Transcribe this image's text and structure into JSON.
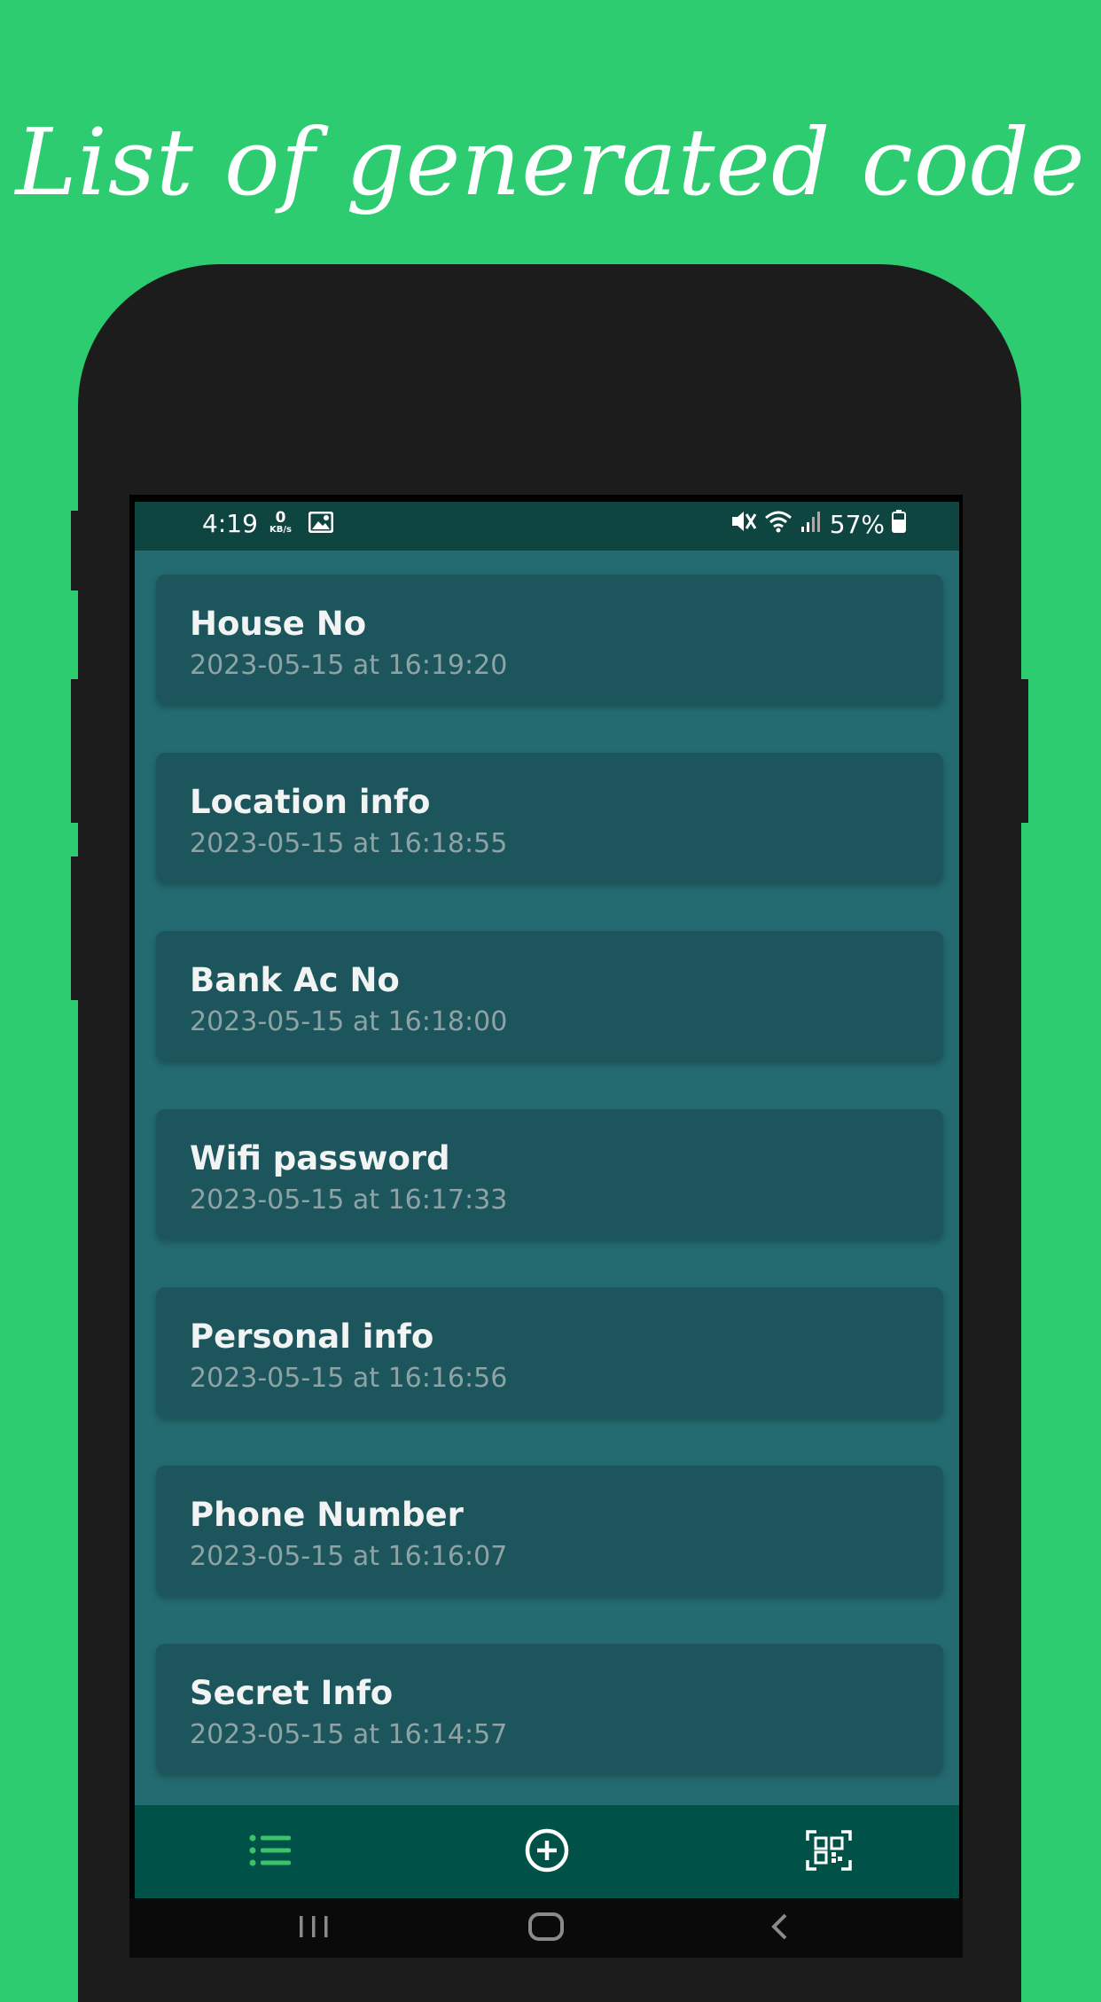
{
  "headline": "List of generated code",
  "status_bar": {
    "time": "4:19",
    "net_speed_value": "0",
    "net_speed_unit": "KB/s",
    "battery": "57%"
  },
  "items": [
    {
      "title": "House No",
      "timestamp": "2023-05-15 at 16:19:20"
    },
    {
      "title": "Location info",
      "timestamp": "2023-05-15 at 16:18:55"
    },
    {
      "title": "Bank Ac No",
      "timestamp": "2023-05-15 at 16:18:00"
    },
    {
      "title": "Wifi password",
      "timestamp": "2023-05-15 at 16:17:33"
    },
    {
      "title": "Personal info",
      "timestamp": "2023-05-15 at 16:16:56"
    },
    {
      "title": "Phone Number",
      "timestamp": "2023-05-15 at 16:16:07"
    },
    {
      "title": "Secret Info",
      "timestamp": "2023-05-15 at 16:14:57"
    }
  ],
  "bottom_nav": {
    "items": [
      {
        "icon": "list-icon",
        "active": true
      },
      {
        "icon": "add-circle-icon",
        "active": false
      },
      {
        "icon": "qr-code-icon",
        "active": false
      }
    ]
  },
  "system_nav": [
    "recents-icon",
    "home-icon",
    "back-icon"
  ],
  "colors": {
    "background": "#2ecc71",
    "phone_frame": "#1c1c1c",
    "status_bar": "#0f4540",
    "list_background": "#236b70",
    "card": "#1d555d",
    "bottom_nav": "#005147",
    "active_icon": "#3cc26a"
  }
}
